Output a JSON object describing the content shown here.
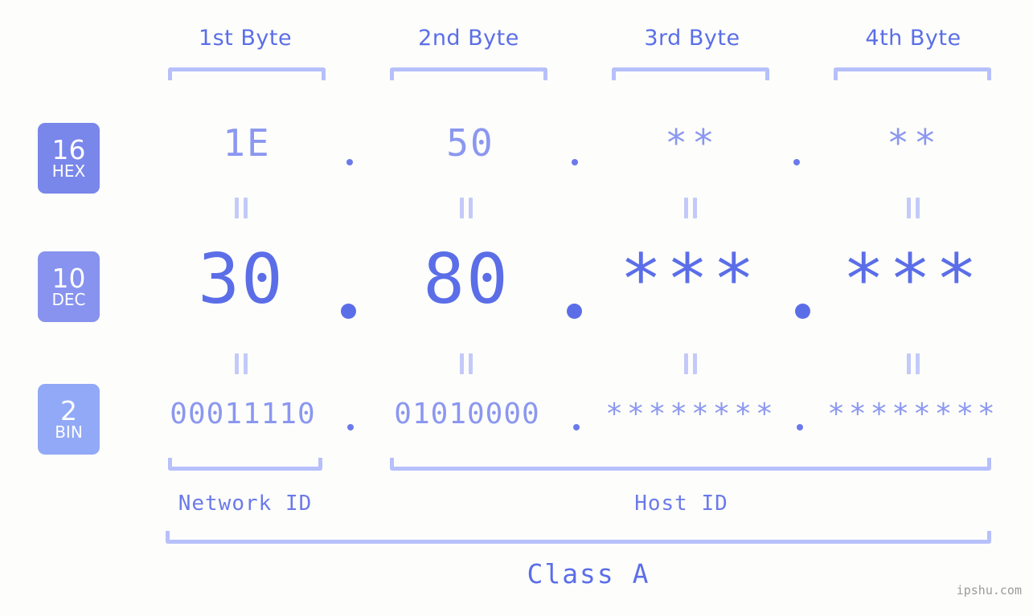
{
  "meta": {
    "watermark": "ipshu.com",
    "background": "#fdfefb",
    "accent": "#5b6ee8",
    "accent_light": "#8b97f0",
    "bracket_color": "#b7c0fb"
  },
  "headers": {
    "bytes": [
      {
        "label": "1st Byte"
      },
      {
        "label": "2nd Byte"
      },
      {
        "label": "3rd Byte"
      },
      {
        "label": "4th Byte"
      }
    ]
  },
  "bases": [
    {
      "number": "16",
      "name": "HEX",
      "color": "#7986ea"
    },
    {
      "number": "10",
      "name": "DEC",
      "color": "#8793ee"
    },
    {
      "number": "2",
      "name": "BIN",
      "color": "#91a9f6"
    }
  ],
  "rows": {
    "hex": {
      "octets": [
        "1E",
        "50",
        "**",
        "**"
      ],
      "separator": "."
    },
    "dec": {
      "octets": [
        "30",
        "80",
        "***",
        "***"
      ],
      "separator": "."
    },
    "bin": {
      "octets": [
        "00011110",
        "01010000",
        "********",
        "********"
      ],
      "separator": "."
    }
  },
  "connectors": {
    "symbol": "="
  },
  "footer": {
    "network_id": "Network ID",
    "host_id": "Host ID",
    "class": "Class A"
  }
}
